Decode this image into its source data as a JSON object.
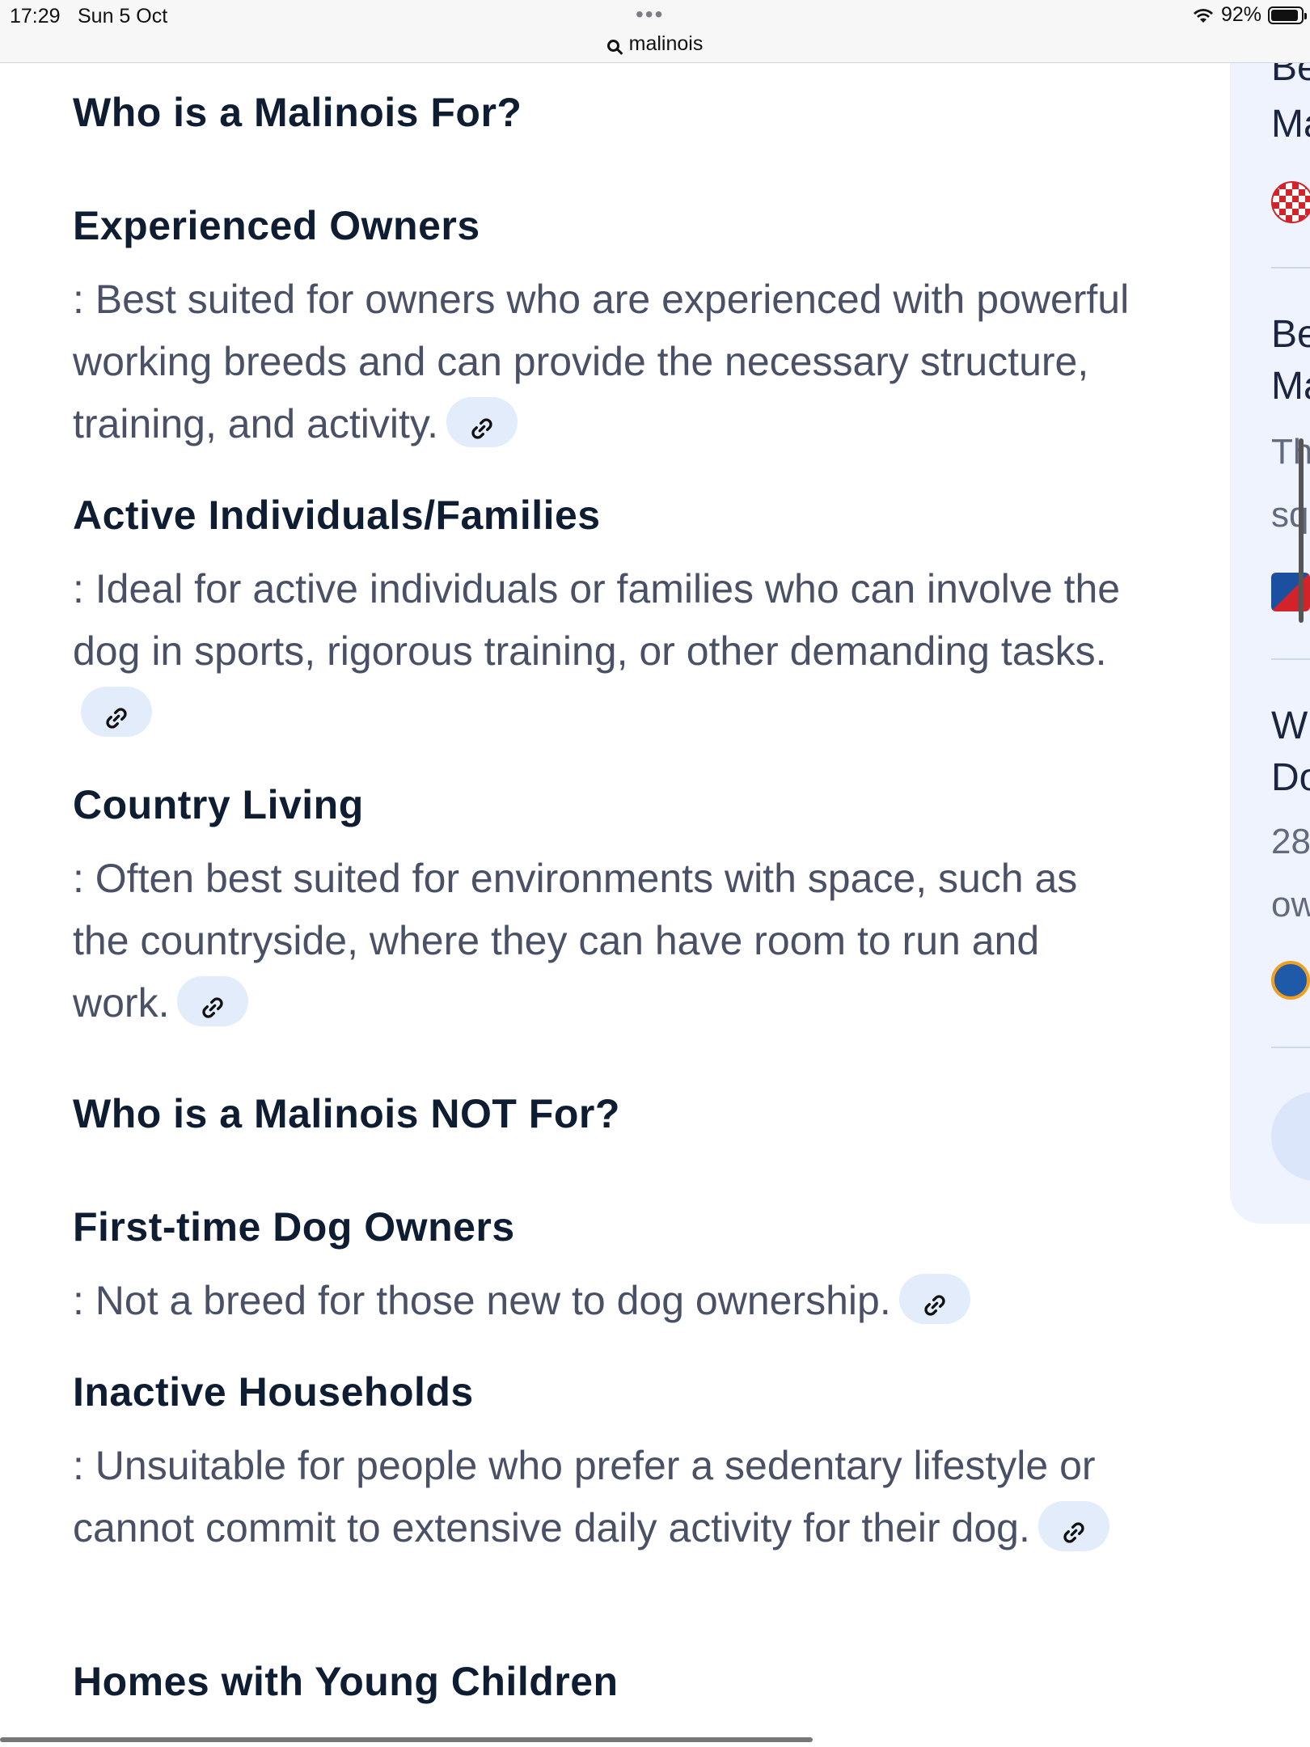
{
  "status_bar": {
    "time": "17:29",
    "date": "Sun 5 Oct",
    "url": "malinois",
    "battery": "92%",
    "battery_level": 0.92
  },
  "content": {
    "section1_title": "Who is a Malinois For?",
    "items_for": [
      {
        "heading": "Experienced Owners",
        "text": ": Best suited for owners who are experienced with powerful working breeds and can provide the necessary structure, training, and activity."
      },
      {
        "heading": "Active Individuals/Families",
        "text": ": Ideal for active individuals or families who can involve the dog in sports, rigorous training, or other demanding tasks."
      },
      {
        "heading": "Country Living",
        "text": ": Often best suited for environments with space, such as the countryside, where they can have room to run and work."
      }
    ],
    "section2_title": "Who is a Malinois NOT For?",
    "items_not_for": [
      {
        "heading": "First-time Dog Owners",
        "text": ": Not a breed for those new to dog ownership."
      },
      {
        "heading": "Inactive Households",
        "text": ": Unsuitable for people who prefer a sedentary lifestyle or cannot commit to extensive daily activity for their dog."
      },
      {
        "heading": "Homes with Young Children",
        "text": ""
      }
    ]
  },
  "side_panel": {
    "card1_line1": "Be",
    "card1_line2": "Ma",
    "card2_line1": "Be",
    "card2_line2": "Ma",
    "card2_line3": "Th",
    "card2_line4": "sq",
    "card3_line1": "W",
    "card3_line2": "Do",
    "card3_line3": "28",
    "card3_line4": "ow"
  }
}
